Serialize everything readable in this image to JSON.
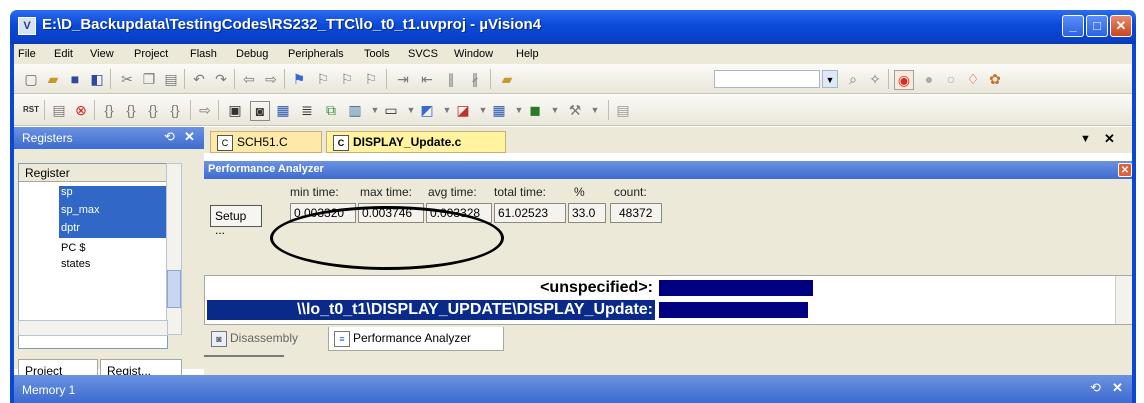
{
  "window": {
    "app_icon": "V",
    "title": "E:\\D_Backupdata\\TestingCodes\\RS232_TTC\\lo_t0_t1.uvproj - µVision4",
    "minimize": "_",
    "maximize": "□",
    "close": "✕"
  },
  "menu": [
    "File",
    "Edit",
    "View",
    "Project",
    "Flash",
    "Debug",
    "Peripherals",
    "Tools",
    "SVCS",
    "Window",
    "Help"
  ],
  "toolbar2": {
    "rst_label": "RST"
  },
  "registers_pane": {
    "title": "Registers",
    "pin": "⟲",
    "close": "✕",
    "column_header": "Register",
    "rows": [
      "sp",
      "sp_max",
      "dptr",
      "PC $",
      "states"
    ],
    "tabs": [
      "Project",
      "Regist..."
    ]
  },
  "editor": {
    "tabs": [
      "SCH51.C",
      "DISPLAY_Update.c"
    ],
    "dropdown": "▼",
    "close": "✕"
  },
  "performance_analyzer": {
    "title": "Performance Analyzer",
    "close": "✕",
    "setup_label": "Setup ...",
    "columns": [
      "min time:",
      "max time:",
      "avg time:",
      "total time:",
      "%",
      "count:"
    ],
    "values": [
      "0.003320",
      "0.003746",
      "0.003328",
      "61.02523",
      "33.0",
      "48372"
    ],
    "rows": [
      {
        "label": "<unspecified>:",
        "fraction": 0.34
      },
      {
        "label": "\\\\lo_t0_t1\\DISPLAY_UPDATE\\DISPLAY_Update:",
        "fraction": 0.33
      }
    ]
  },
  "bottom_tabs": [
    "Disassembly",
    "Performance Analyzer"
  ],
  "memory_pane": {
    "title": "Memory 1",
    "pin": "⟲",
    "close": "✕"
  }
}
